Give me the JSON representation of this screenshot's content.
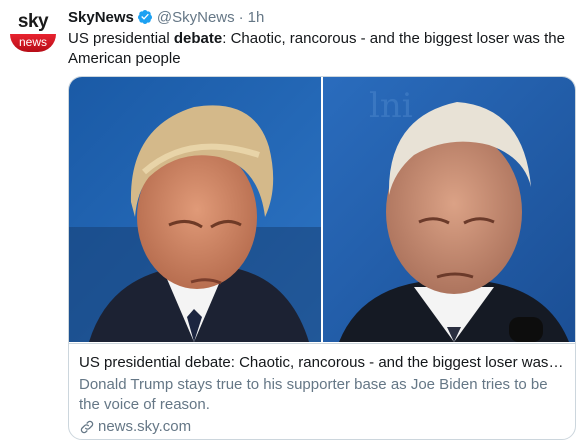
{
  "author": {
    "avatar_top": "sky",
    "avatar_bottom": "news",
    "display_name": "SkyNews",
    "handle": "@SkyNews",
    "separator": "·",
    "time": "1h",
    "verified": true
  },
  "tweet": {
    "text_before": "US presidential ",
    "text_bold": "debate",
    "text_after": ": Chaotic, rancorous - and the biggest loser was the American people"
  },
  "card": {
    "title": "US presidential debate: Chaotic, rancorous - and the biggest loser was t...",
    "description": "Donald Trump stays true to his supporter base as Joe Biden tries to be the voice of reason.",
    "domain": "news.sky.com"
  },
  "colors": {
    "verified": "#1da1f2",
    "secondary_text": "#657786",
    "card_border": "#ccd6dd",
    "sky_red": "#d41a26",
    "debate_blue": "#1f5fa8"
  },
  "icons": {
    "verified": "verified-badge-icon",
    "link": "link-icon"
  }
}
